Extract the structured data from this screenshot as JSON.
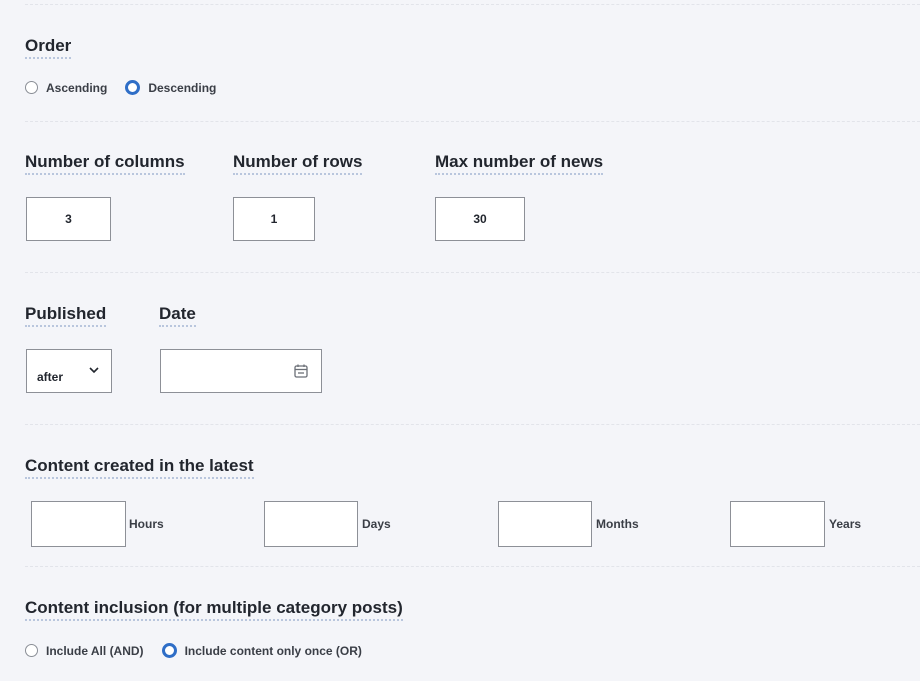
{
  "order": {
    "label": "Order",
    "options": [
      {
        "label": "Ascending",
        "checked": false
      },
      {
        "label": "Descending",
        "checked": true
      }
    ]
  },
  "layout": {
    "columns": {
      "label": "Number of columns",
      "value": "3"
    },
    "rows": {
      "label": "Number of rows",
      "value": "1"
    },
    "max_news": {
      "label": "Max number of news",
      "value": "30"
    }
  },
  "published": {
    "label": "Published",
    "selected": "after"
  },
  "date": {
    "label": "Date",
    "value": ""
  },
  "latest": {
    "label": "Content created in the latest",
    "units": [
      "Hours",
      "Days",
      "Months",
      "Years"
    ]
  },
  "inclusion": {
    "label": "Content inclusion (for multiple category posts)",
    "options": [
      {
        "label": "Include All (AND)",
        "checked": false
      },
      {
        "label": "Include content only once (OR)",
        "checked": true
      }
    ]
  },
  "colors": {
    "background": "#f4f5f9",
    "accent": "#2f6ec7",
    "border": "#8d9097"
  },
  "icons": {
    "select": "chevron-down-icon",
    "date": "calendar-icon"
  }
}
